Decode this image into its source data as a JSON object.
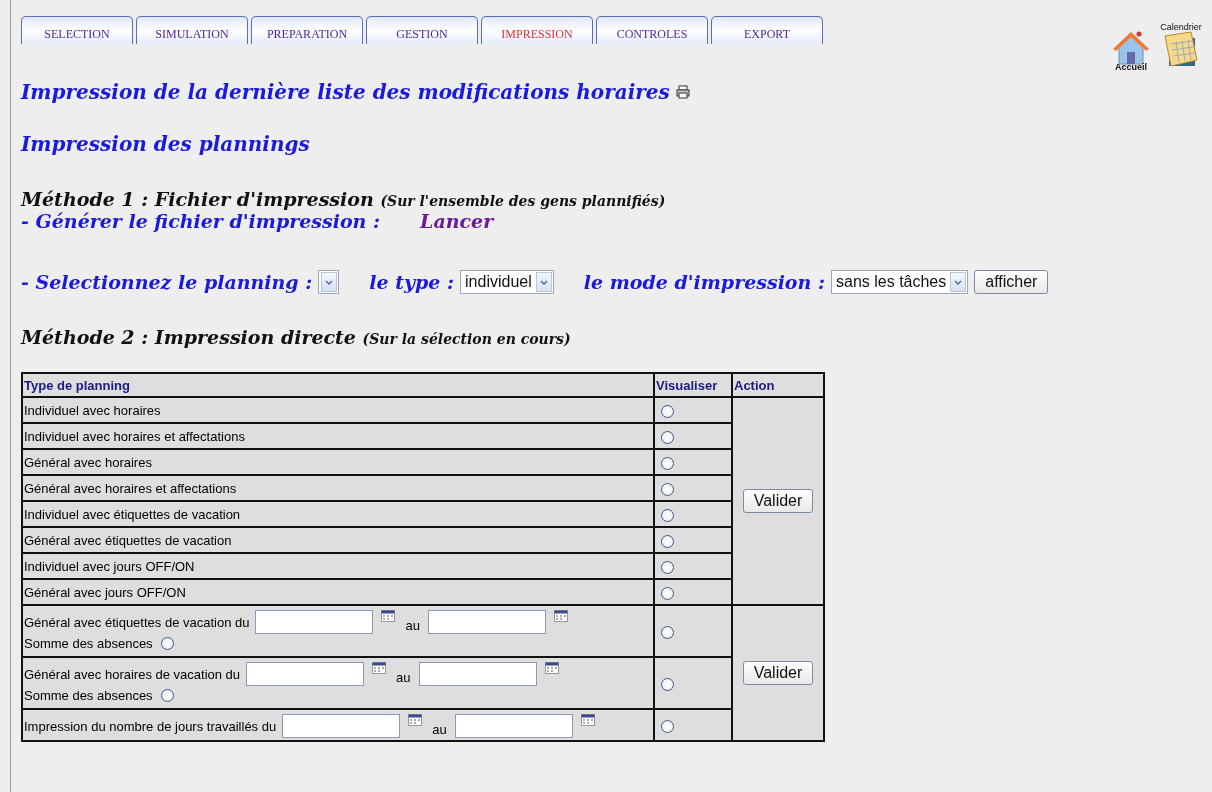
{
  "tabs": [
    {
      "label": "SELECTION",
      "selected": false
    },
    {
      "label": "SIMULATION",
      "selected": false
    },
    {
      "label": "PREPARATION",
      "selected": false
    },
    {
      "label": "GESTION",
      "selected": false
    },
    {
      "label": "IMPRESSION",
      "selected": true
    },
    {
      "label": "CONTROLES",
      "selected": false
    },
    {
      "label": "EXPORT",
      "selected": false
    }
  ],
  "shortcuts": [
    {
      "kind": "home",
      "label": "Accueil"
    },
    {
      "kind": "calendar",
      "label": "Calendrier"
    }
  ],
  "last_modifications_link": "Impression de la dernière liste des modifications horaires",
  "section_title": "Impression des plannings",
  "method1": {
    "title": "Méthode 1 : Fichier d'impression",
    "note": "(Sur l'ensemble des gens plannifiés)",
    "generate_label": "- Générer le fichier d'impression :",
    "launch_link": "Lancer",
    "planning_label": "- Selectionnez le planning :",
    "type_label": "le type :",
    "type_select": {
      "value": "individuel"
    },
    "mode_label": "le mode d'impression :",
    "mode_select": {
      "value": "sans les tâches"
    },
    "show_button": "afficher"
  },
  "method2": {
    "title": "Méthode 2 : Impression directe",
    "note": "(Sur la sélection en cours)",
    "columns": [
      "Type de planning",
      "Visualiser",
      "Action"
    ],
    "groups": [
      {
        "button": "Valider",
        "rows": [
          {
            "kind": "simple",
            "label": "Individuel avec horaires",
            "selected": false
          },
          {
            "kind": "simple",
            "label": "Individuel avec horaires et affectations",
            "selected": false
          },
          {
            "kind": "simple",
            "label": "Général avec horaires",
            "selected": false
          },
          {
            "kind": "simple",
            "label": "Général avec horaires et affectations",
            "selected": false
          },
          {
            "kind": "simple",
            "label": "Individuel avec étiquettes de vacation",
            "selected": false
          },
          {
            "kind": "simple",
            "label": "Général avec étiquettes de vacation",
            "selected": false
          },
          {
            "kind": "simple",
            "label": "Individuel avec jours OFF/ON",
            "selected": false
          },
          {
            "kind": "simple",
            "label": "Général avec jours OFF/ON",
            "selected": false
          }
        ]
      },
      {
        "button": "Valider",
        "rows": [
          {
            "kind": "range",
            "label": "Général avec étiquettes de vacation du",
            "to_label": "au",
            "absence_label": "Somme des absences",
            "absence_selected": false,
            "selected": false
          },
          {
            "kind": "range",
            "label": "Général avec horaires de vacation du",
            "to_label": "au",
            "absence_label": "Somme des absences",
            "absence_selected": false,
            "selected": false
          },
          {
            "kind": "range",
            "label": "Impression du nombre de jours travaillés du",
            "to_label": "au",
            "selected": false
          }
        ]
      }
    ]
  }
}
